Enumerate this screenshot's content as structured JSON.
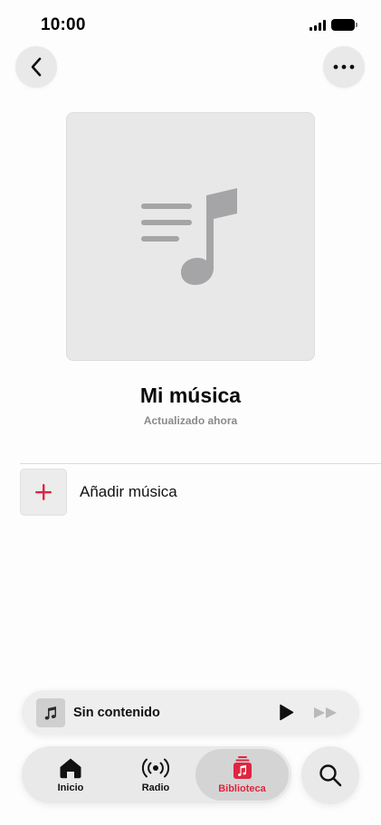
{
  "status_bar": {
    "time": "10:00"
  },
  "playlist": {
    "title": "Mi música",
    "subtitle": "Actualizado ahora"
  },
  "actions": {
    "add_music_label": "Añadir música"
  },
  "mini_player": {
    "title": "Sin contenido"
  },
  "tab_bar": {
    "selected": "Biblioteca",
    "tabs": [
      {
        "label": "Inicio",
        "icon": "home-icon"
      },
      {
        "label": "Radio",
        "icon": "radio-icon"
      },
      {
        "label": "Biblioteca",
        "icon": "library-icon"
      }
    ]
  },
  "colors": {
    "accent": "#e0253f",
    "background": "#fdfdfd",
    "artwork": "#e8e8e8"
  }
}
